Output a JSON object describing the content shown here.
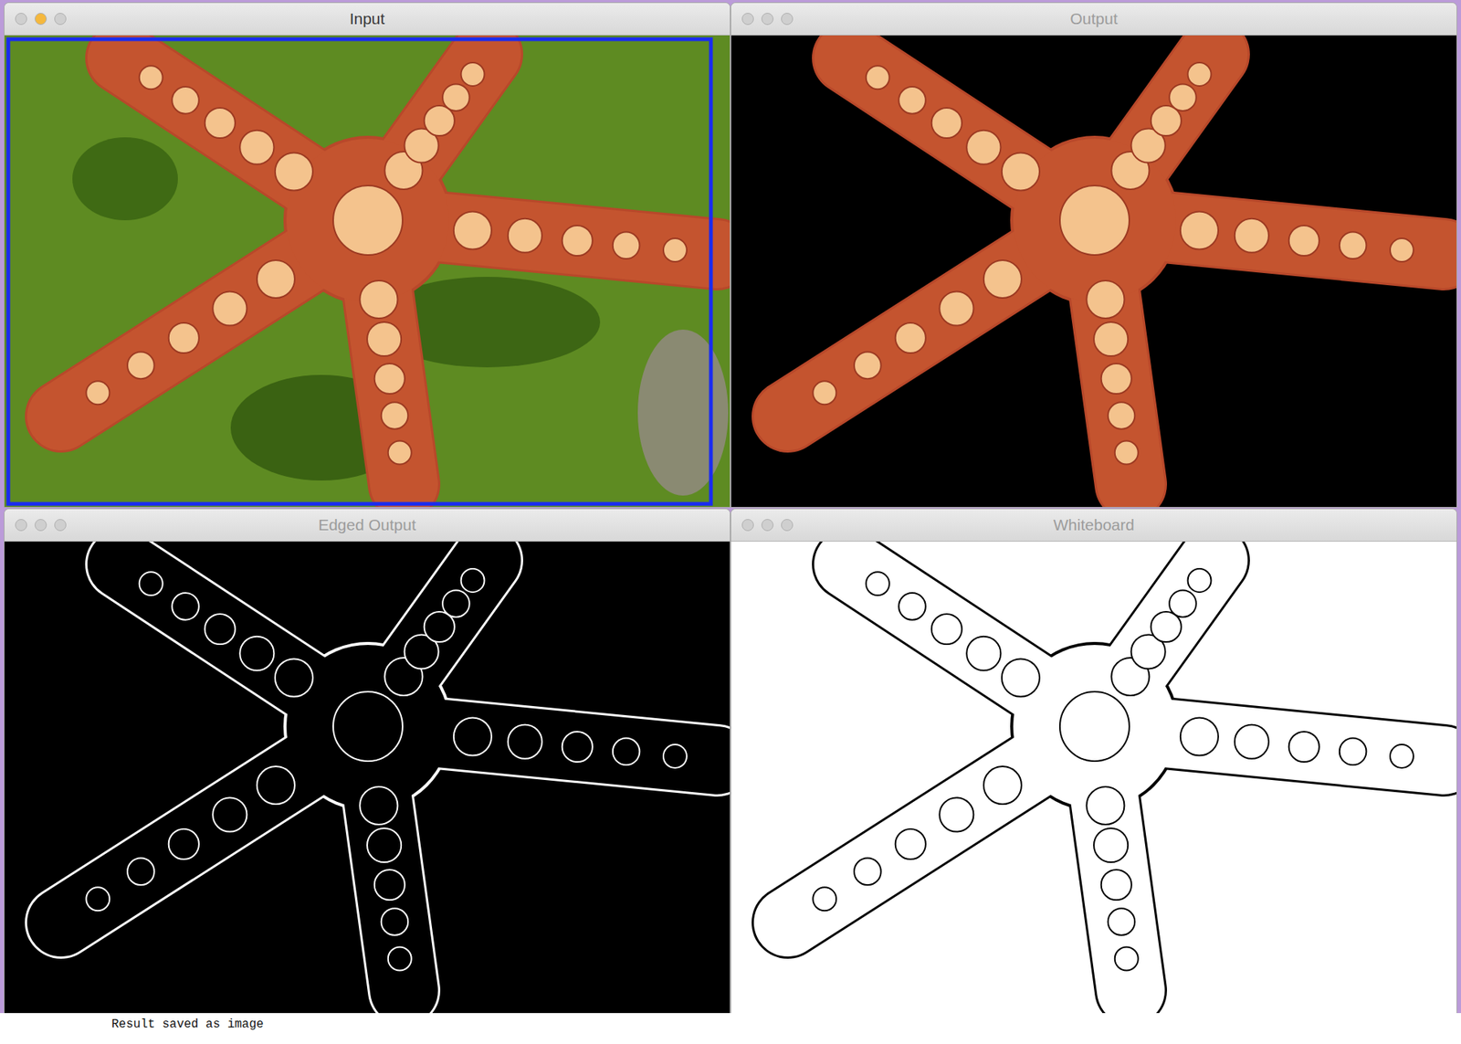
{
  "windows": [
    {
      "title": "Input",
      "active": true,
      "kind": "photo",
      "lights": [
        {
          "color": "#cfcfcf"
        },
        {
          "color": "#f5b83d"
        },
        {
          "color": "#cfcfcf"
        }
      ]
    },
    {
      "title": "Output",
      "active": false,
      "kind": "cutout",
      "lights": [
        {
          "color": "#cfcfcf"
        },
        {
          "color": "#cfcfcf"
        },
        {
          "color": "#cfcfcf"
        }
      ]
    },
    {
      "title": "Edged Output",
      "active": false,
      "kind": "edges-dark",
      "lights": [
        {
          "color": "#cfcfcf"
        },
        {
          "color": "#cfcfcf"
        },
        {
          "color": "#cfcfcf"
        }
      ]
    },
    {
      "title": "Whiteboard",
      "active": false,
      "kind": "edges-light",
      "lights": [
        {
          "color": "#cfcfcf"
        },
        {
          "color": "#cfcfcf"
        },
        {
          "color": "#cfcfcf"
        }
      ]
    }
  ],
  "terminal": {
    "lines": [
      "Result saved as image"
    ]
  }
}
